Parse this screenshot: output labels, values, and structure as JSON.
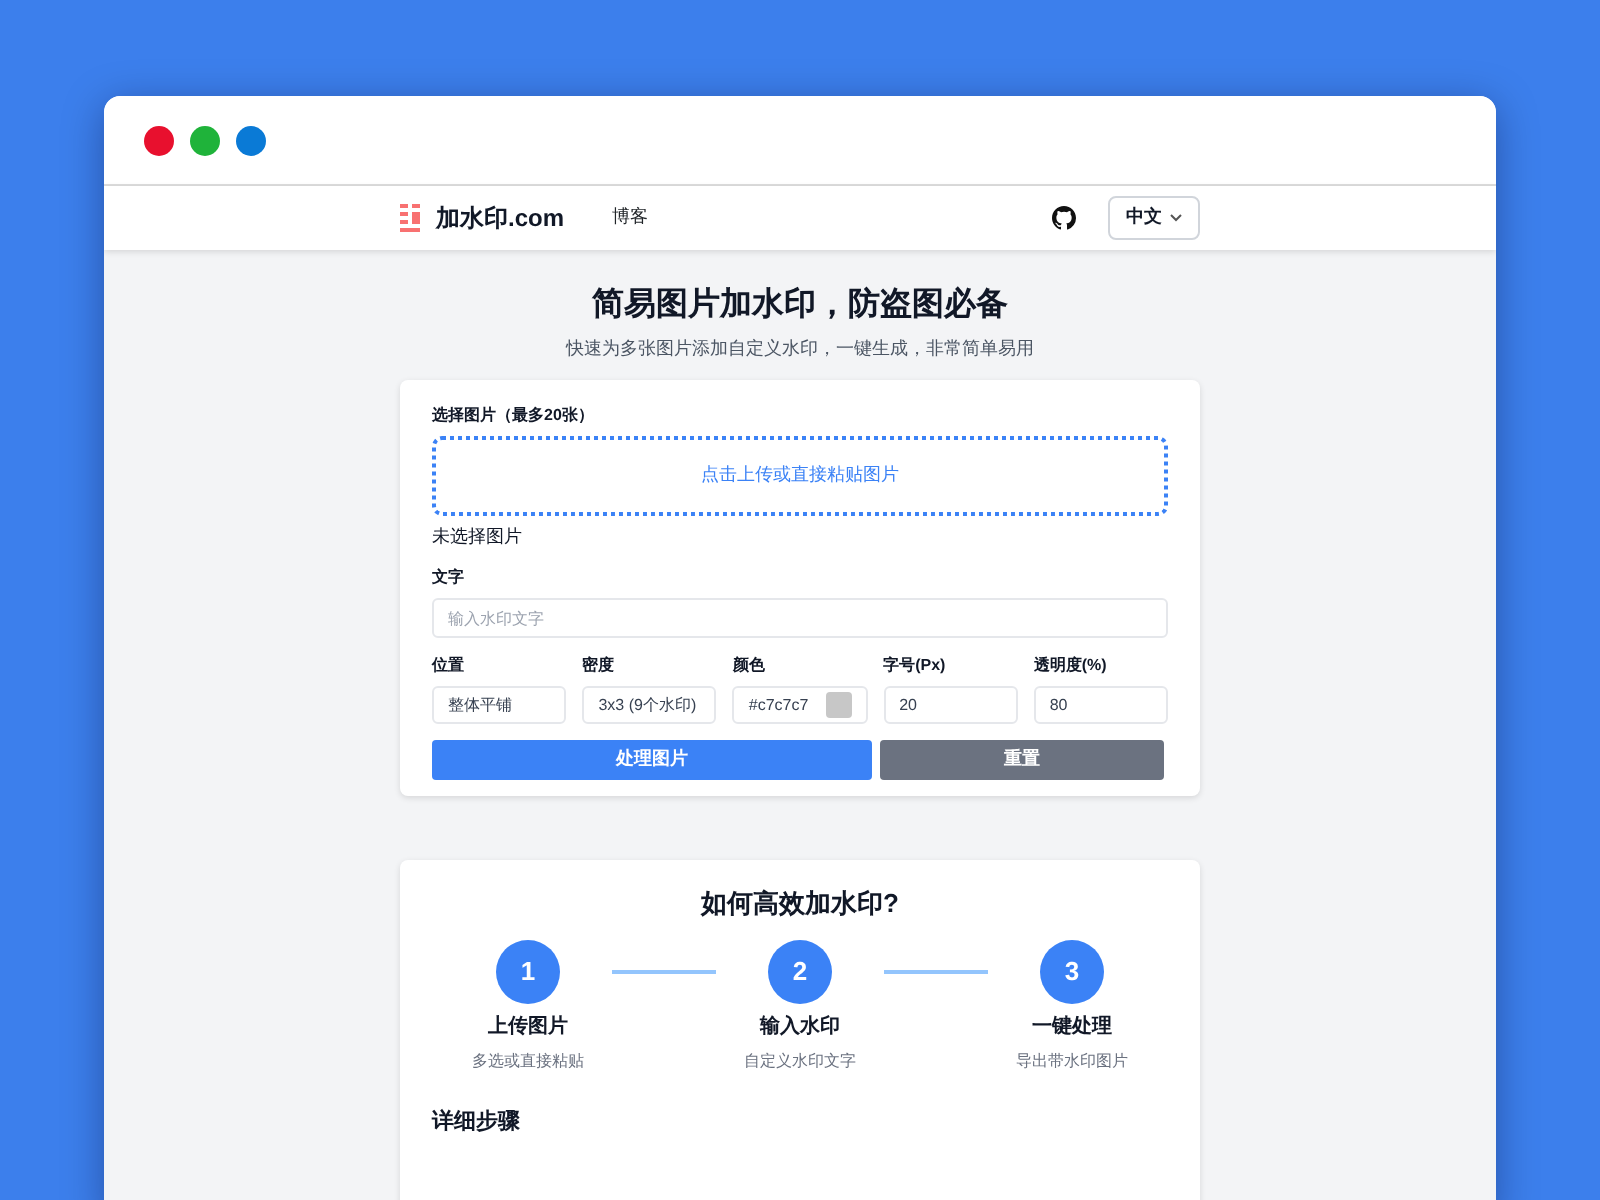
{
  "window": {
    "dots": [
      {
        "color": "#e8102e"
      },
      {
        "color": "#1fb33a"
      },
      {
        "color": "#0a7ad6"
      }
    ]
  },
  "navbar": {
    "brand": "加水印.com",
    "links": [
      "博客"
    ],
    "language": "中文"
  },
  "hero": {
    "title": "简易图片加水印，防盗图必备",
    "subtitle": "快速为多张图片添加自定义水印，一键生成，非常简单易用"
  },
  "form": {
    "upload_label": "选择图片（最多20张）",
    "dropzone": "点击上传或直接粘贴图片",
    "file_status": "未选择图片",
    "text_label": "文字",
    "text_placeholder": "输入水印文字",
    "fields": [
      {
        "kind": "select",
        "label": "位置",
        "value": "整体平铺"
      },
      {
        "kind": "select",
        "label": "密度",
        "value": "3x3 (9个水印)"
      },
      {
        "kind": "color",
        "label": "颜色",
        "value": "#c7c7c7",
        "color": "#c7c7c7"
      },
      {
        "kind": "number",
        "label": "字号(Px)",
        "value": "20"
      },
      {
        "kind": "number",
        "label": "透明度(%)",
        "value": "80"
      }
    ],
    "buttons": [
      {
        "kind": "primary",
        "label": "处理图片"
      },
      {
        "kind": "secondary",
        "label": "重置"
      }
    ]
  },
  "howto": {
    "title": "如何高效加水印?",
    "steps": [
      {
        "number": "1",
        "title": "上传图片",
        "caption": "多选或直接粘贴"
      },
      {
        "number": "2",
        "title": "输入水印",
        "caption": "自定义水印文字"
      },
      {
        "number": "3",
        "title": "一键处理",
        "caption": "导出带水印图片"
      }
    ],
    "details_heading": "详细步骤"
  }
}
